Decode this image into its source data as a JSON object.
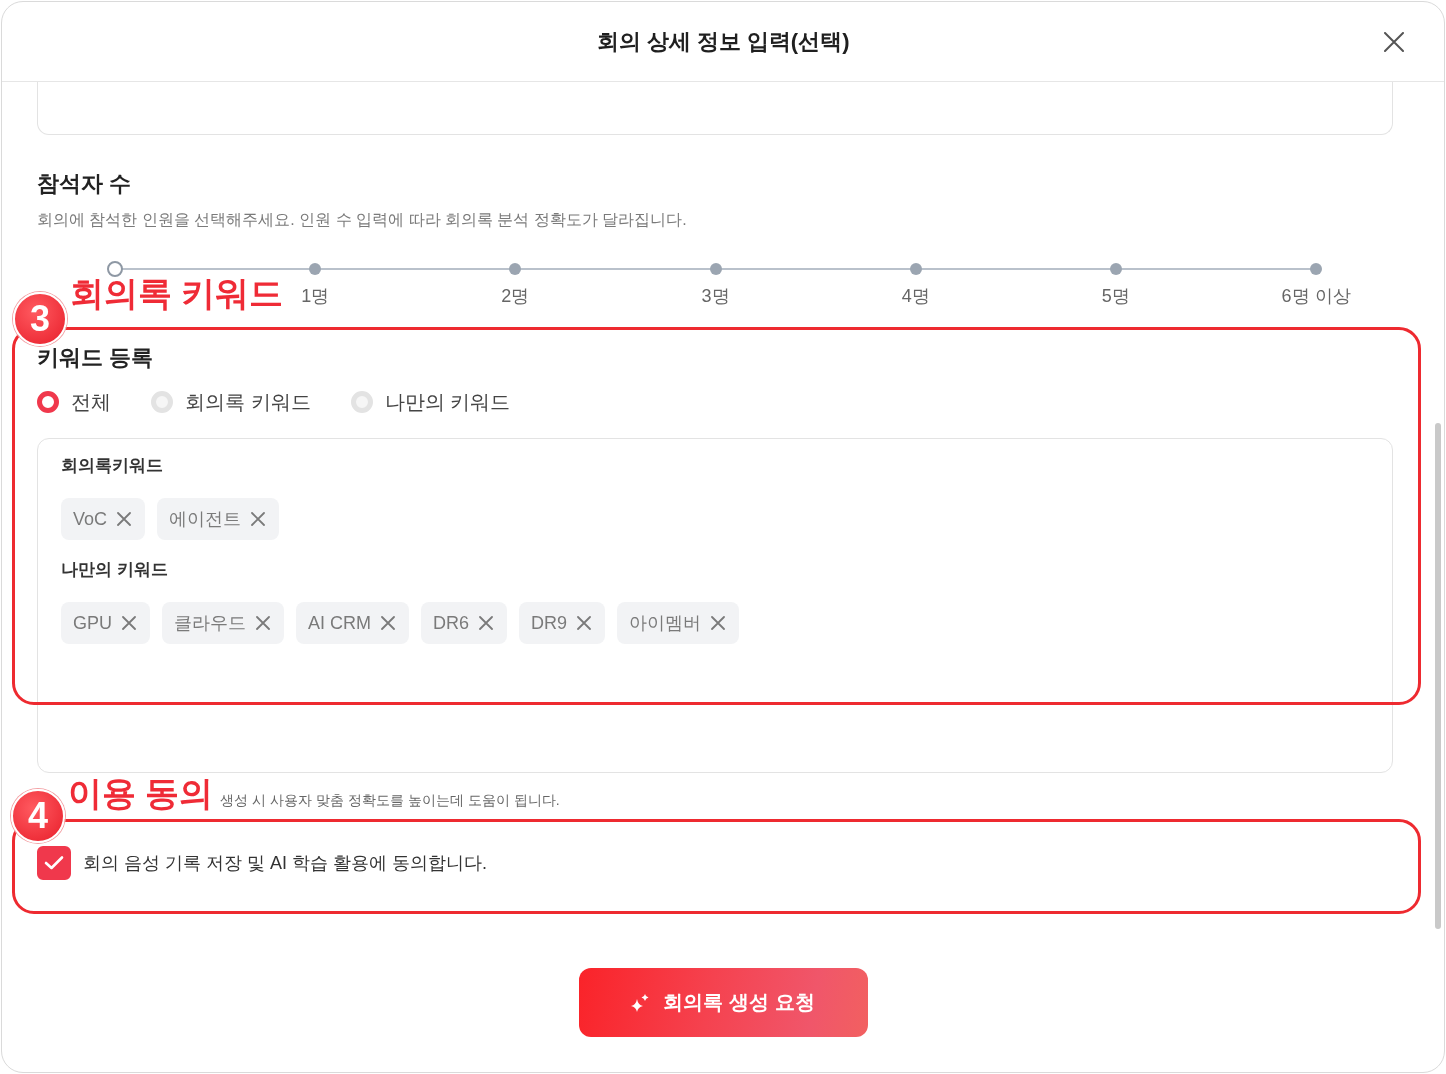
{
  "dialog": {
    "title": "회의 상세 정보 입력(선택)"
  },
  "attendees": {
    "title": "참석자 수",
    "description": "회의에 참석한 인원을 선택해주세요. 인원 수 입력에 따라 회의록 분석 정확도가 달라집니다.",
    "slider": {
      "level": 0,
      "tick_labels": [
        "1명",
        "2명",
        "3명",
        "4명",
        "5명",
        "6명 이상"
      ]
    }
  },
  "keywords": {
    "annotation": {
      "number": "3",
      "label": "회의록 키워드"
    },
    "title": "키워드 등록",
    "filter_options": [
      {
        "label": "전체",
        "selected": true
      },
      {
        "label": "회의록 키워드",
        "selected": false
      },
      {
        "label": "나만의 키워드",
        "selected": false
      }
    ],
    "groups": [
      {
        "title": "회의록키워드",
        "tags": [
          "VoC",
          "에이전트"
        ]
      },
      {
        "title": "나만의 키워드",
        "tags": [
          "GPU",
          "클라우드",
          "AI CRM",
          "DR6",
          "DR9",
          "아이멤버"
        ]
      }
    ]
  },
  "consent": {
    "annotation": {
      "number": "4",
      "label": "이용 동의"
    },
    "hint": "생성 시 사용자 맞춤 정확도를 높이는데 도움이 됩니다.",
    "label": "회의 음성 기록 저장 및 AI 학습 활용에 동의합니다.",
    "checked": true
  },
  "submit_button": {
    "label": "회의록 생성 요청"
  }
}
